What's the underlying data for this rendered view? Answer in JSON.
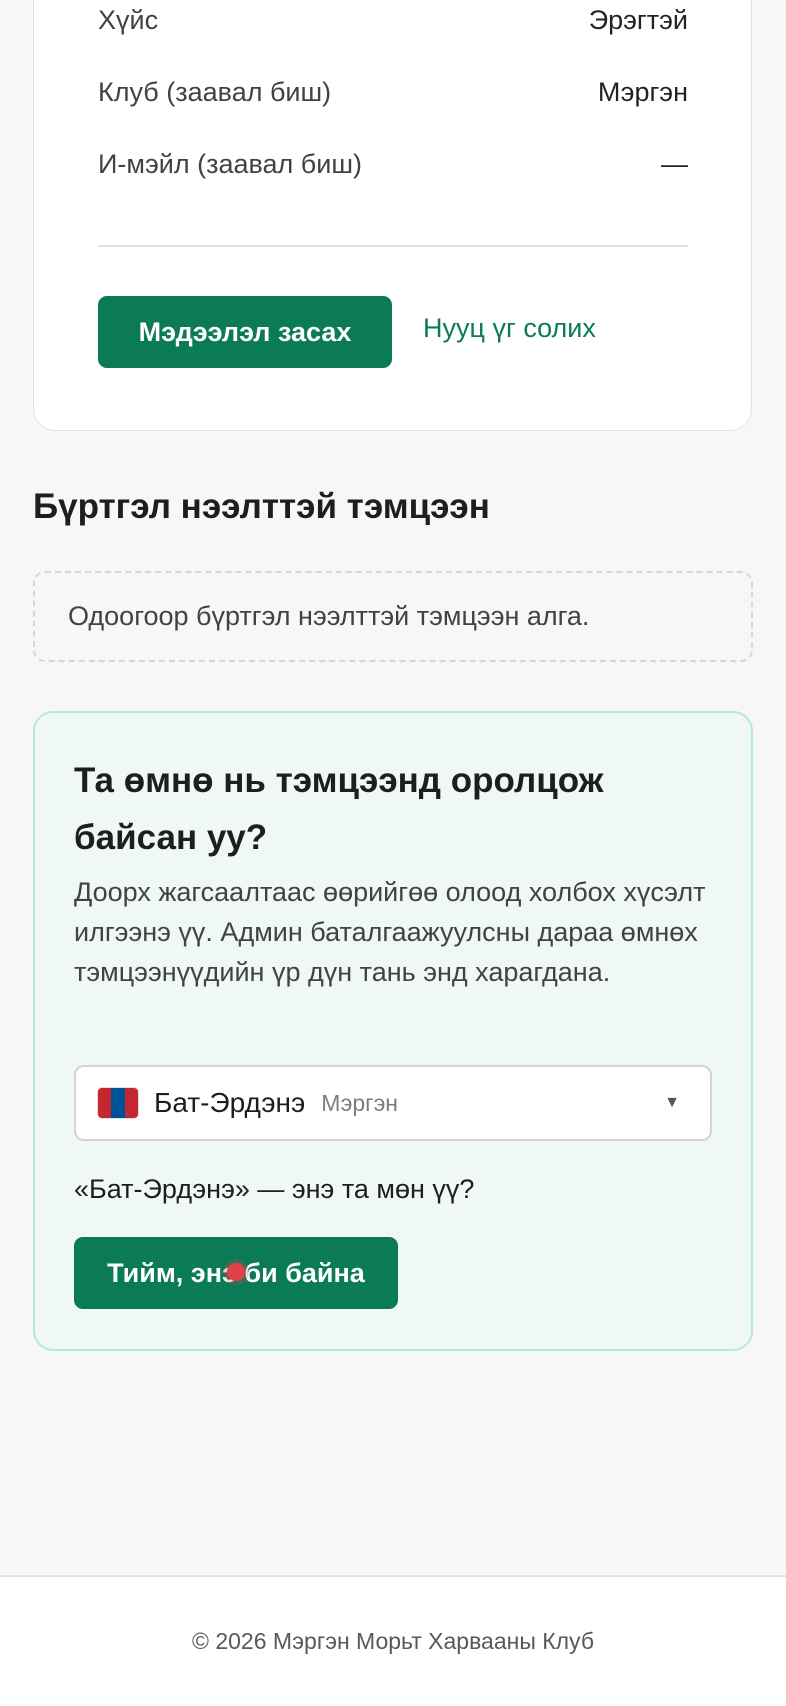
{
  "profile": {
    "rows": [
      {
        "label": "Хүйс",
        "value": "Эрэгтэй"
      },
      {
        "label": "Клуб (заавал биш)",
        "value": "Мэргэн"
      },
      {
        "label": "И-мэйл (заавал биш)",
        "value": "—"
      }
    ],
    "edit_button": "Мэдээлэл засах",
    "password_link": "Нууц үг солих"
  },
  "registrations": {
    "title": "Бүртгэл нээлттэй тэмцээн",
    "empty_text": "Одоогоор бүртгэл нээлттэй тэмцээн алга."
  },
  "claim": {
    "title": "Та өмнө нь тэмцээнд оролцож байсан уу?",
    "description": "Доорх жагсаалтаас өөрийгөө олоод холбох хүсэлт илгээнэ үү. Админ баталгаажуулсны дараа өмнөх тэмцээнүүдийн үр дүн тань энд харагдана.",
    "selected": {
      "name": "Бат-Эрдэнэ",
      "club": "Мэргэн",
      "flag_icon": "mongolia-flag-icon"
    },
    "confirm_question": "«Бат-Эрдэнэ» — энэ та мөн үү?",
    "confirm_button": "Тийм, энэ би байна"
  },
  "footer": {
    "text": "© 2026 Мэргэн Морьт Харвааны Клуб"
  },
  "colors": {
    "accent": "#0b7a57",
    "claim_bg": "#f0f8f4",
    "claim_border": "#b3ecd2",
    "page_bg": "#f7f7f5"
  }
}
